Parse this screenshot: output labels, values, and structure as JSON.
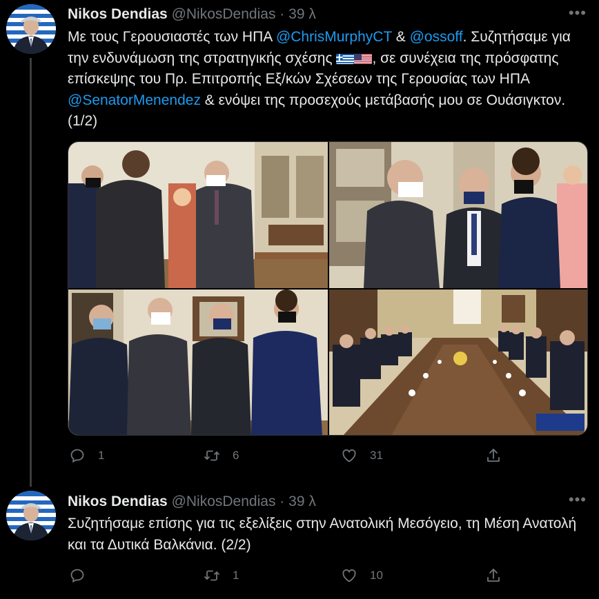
{
  "tweets": [
    {
      "author": {
        "name": "Nikos Dendias",
        "handle": "@NikosDendias"
      },
      "separator": "·",
      "time": "39 λ",
      "text": {
        "p1": "Με τους Γερουσιαστές των ΗΠΑ ",
        "m1": "@ChrisMurphyCT",
        "p2": " & ",
        "m2": "@ossoff",
        "p3": ". Συζητήσαμε για την ενδυνάμωση της στρατηγικής σχέσης ",
        "p4": ", σε συνέχεια της πρόσφατης επίσκεψης του Πρ. Επιτροπής Εξ/κών Σχέσεων της Γερουσίας των ΗΠΑ ",
        "m3": "@SenatorMenendez",
        "p5": " & ενόψει της προσεχούς μετάβασής μου σε Ουάσιγκτον. (1/2)"
      },
      "flags": [
        "greece-flag",
        "usa-flag"
      ],
      "actions": {
        "replies": "1",
        "retweets": "6",
        "likes": "31"
      }
    },
    {
      "author": {
        "name": "Nikos Dendias",
        "handle": "@NikosDendias"
      },
      "separator": "·",
      "time": "39 λ",
      "text": "Συζητήσαμε επίσης για τις εξελίξεις στην Ανατολική Μεσόγειο, τη Μέση Ανατολή και τα Δυτικά Βαλκάνια. (2/2)",
      "actions": {
        "replies": "",
        "retweets": "1",
        "likes": "10"
      }
    }
  ],
  "colors": {
    "background": "#000000",
    "mention": "#1d9bf0",
    "muted": "#71767b",
    "text": "#e7e9ea"
  },
  "icons": [
    "more-icon",
    "reply-icon",
    "retweet-icon",
    "like-icon",
    "share-icon"
  ]
}
